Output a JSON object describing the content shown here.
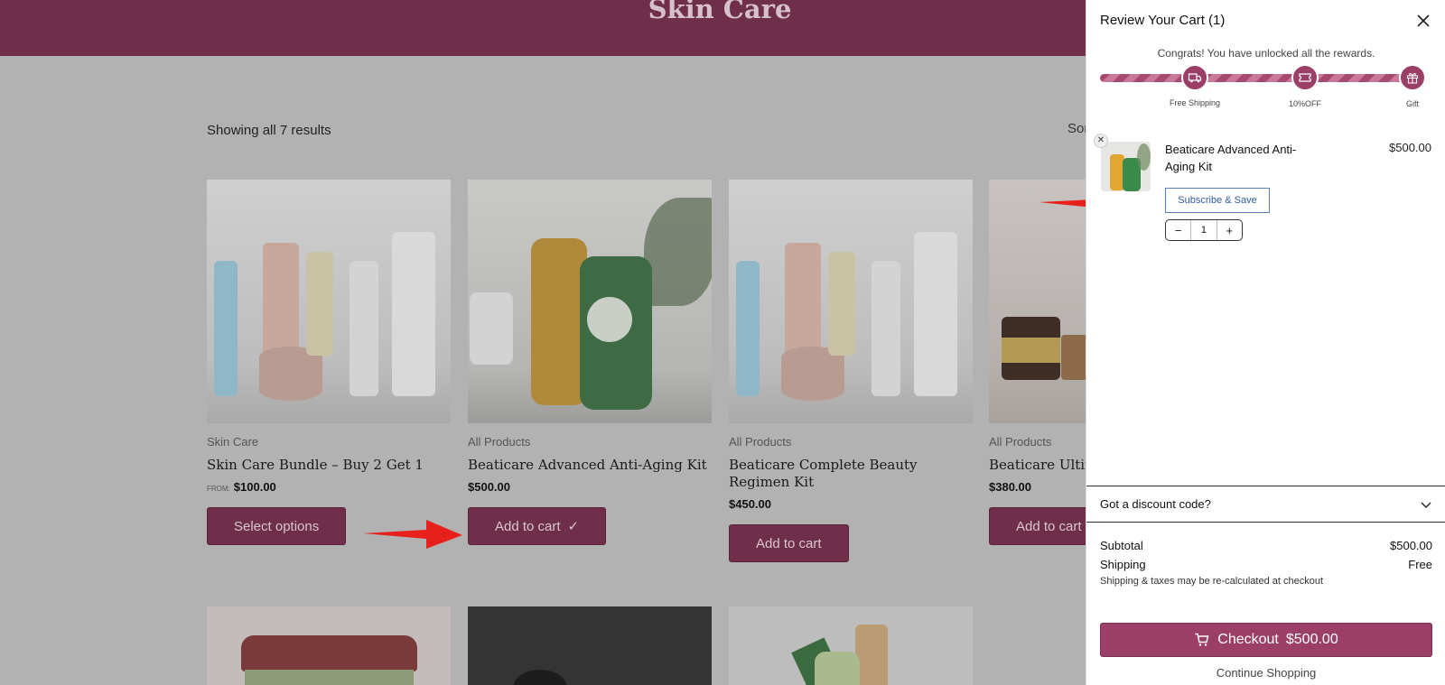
{
  "store": {
    "banner_title": "Skin Care",
    "results_text": "Showing all 7 results",
    "sort_text": "Sor"
  },
  "products": [
    {
      "category": "Skin Care",
      "title": "Skin Care Bundle – Buy 2 Get 1",
      "price_prefix": "FROM:",
      "price": "$100.00",
      "button": "Select options"
    },
    {
      "category": "All Products",
      "title": "Beaticare Advanced Anti-Aging Kit",
      "price": "$500.00",
      "button": "Add to cart"
    },
    {
      "category": "All Products",
      "title": "Beaticare Complete Beauty Regimen Kit",
      "price": "$450.00",
      "button": "Add to cart"
    },
    {
      "category": "All Products",
      "title": "Beaticare Ultima",
      "price": "$380.00",
      "button": "Add to cart"
    }
  ],
  "cart": {
    "title": "Review Your Cart (1)",
    "congrats": "Congrats! You have unlocked all the rewards.",
    "milestones": [
      {
        "label": "Free Shipping"
      },
      {
        "label": "10%OFF"
      },
      {
        "label": "Gift"
      }
    ],
    "item": {
      "name": "Beaticare Advanced Anti-Aging Kit",
      "price": "$500.00",
      "subscribe_label": "Subscribe & Save",
      "quantity": "1",
      "qty_minus": "−",
      "qty_plus": "+"
    },
    "discount_label": "Got a discount code?",
    "subtotal_label": "Subtotal",
    "subtotal_value": "$500.00",
    "shipping_label": "Shipping",
    "shipping_value": "Free",
    "shipping_note": "Shipping & taxes may be re-calculated at checkout",
    "checkout_label": "Checkout",
    "checkout_amount": "$500.00",
    "continue_label": "Continue Shopping"
  },
  "colors": {
    "brand": "#6f2f4a",
    "checkout": "#9b3f66",
    "subscribe_border": "#5a7fbf",
    "arrow": "#e8201c"
  },
  "icons": {
    "close": "close-icon",
    "truck": "truck-icon",
    "coupon": "coupon-icon",
    "gift": "gift-icon",
    "cart": "cart-icon",
    "chevron": "chevron-down-icon",
    "check": "check-icon"
  }
}
